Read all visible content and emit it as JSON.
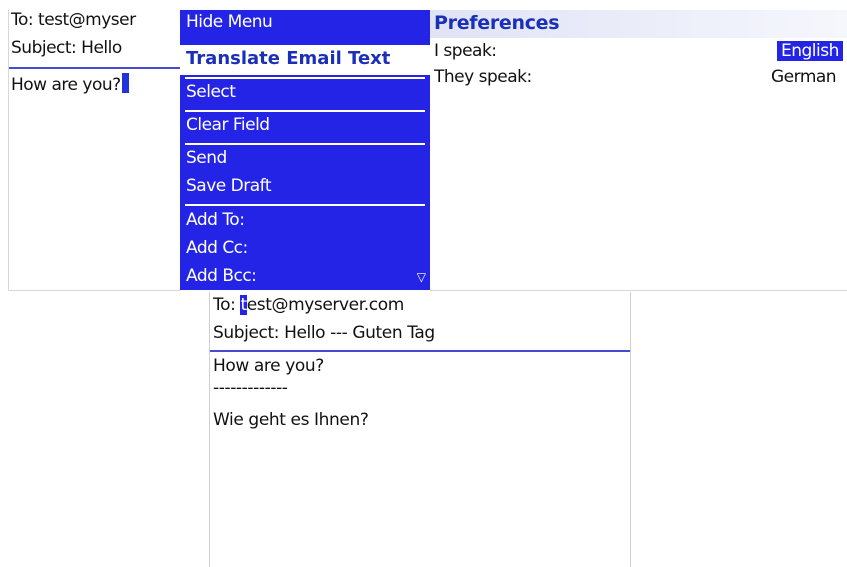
{
  "compose": {
    "to_line": "To: test@myser",
    "subject_line": "Subject: Hello",
    "body_text": "How are you?"
  },
  "menu": {
    "items": [
      "Hide Menu",
      "Translate Email Text",
      "Select",
      "Clear Field",
      "Send",
      "Save Draft",
      "Add To:",
      "Add Cc:",
      "Add Bcc:"
    ],
    "highlighted_item": "Translate Email Text",
    "more_icon": "triangle-down-icon"
  },
  "preferences": {
    "title": "Preferences",
    "i_speak_label": "I speak:",
    "i_speak_value": "English",
    "they_speak_label": "They speak:",
    "they_speak_value": "German"
  },
  "translated": {
    "to_prefix": "To: ",
    "to_cursor_char": "t",
    "to_rest": "est@myserver.com",
    "subject_line": "Subject: Hello --- Guten Tag",
    "body_line_1": "How are you?",
    "body_divider": "-------------",
    "body_line_2": "Wie geht es Ihnen?"
  },
  "colors": {
    "menu_blue": "#2424e6",
    "highlight_text": "#1c2fb8",
    "separator": "#4a4ad0"
  }
}
